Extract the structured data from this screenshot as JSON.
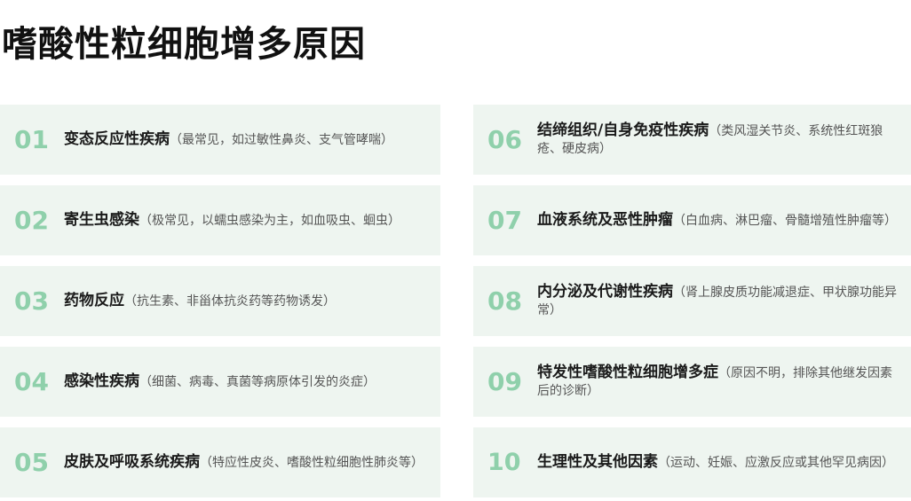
{
  "title": "嗜酸性粒细胞增多原因",
  "items": [
    {
      "num": "01",
      "head": "变态反应性疾病",
      "desc": "（最常见，如过敏性鼻炎、支气管哮喘）"
    },
    {
      "num": "02",
      "head": "寄生虫感染",
      "desc": "（极常见，以蠕虫感染为主，如血吸虫、蛔虫）"
    },
    {
      "num": "03",
      "head": "药物反应",
      "desc": "（抗生素、非甾体抗炎药等药物诱发）"
    },
    {
      "num": "04",
      "head": "感染性疾病",
      "desc": "（细菌、病毒、真菌等病原体引发的炎症）"
    },
    {
      "num": "05",
      "head": "皮肤及呼吸系统疾病",
      "desc": "（特应性皮炎、嗜酸性粒细胞性肺炎等）"
    },
    {
      "num": "06",
      "head": "结缔组织/自身免疫性疾病",
      "desc": "（类风湿关节炎、系统性红斑狼疮、硬皮病）"
    },
    {
      "num": "07",
      "head": "血液系统及恶性肿瘤",
      "desc": "（白血病、淋巴瘤、骨髓增殖性肿瘤等）"
    },
    {
      "num": "08",
      "head": "内分泌及代谢性疾病",
      "desc": "（肾上腺皮质功能减退症、甲状腺功能异常）"
    },
    {
      "num": "09",
      "head": "特发性嗜酸性粒细胞增多症",
      "desc": "（原因不明，排除其他继发因素后的诊断）"
    },
    {
      "num": "10",
      "head": "生理性及其他因素",
      "desc": "（运动、妊娠、应激反应或其他罕见病因）"
    }
  ]
}
